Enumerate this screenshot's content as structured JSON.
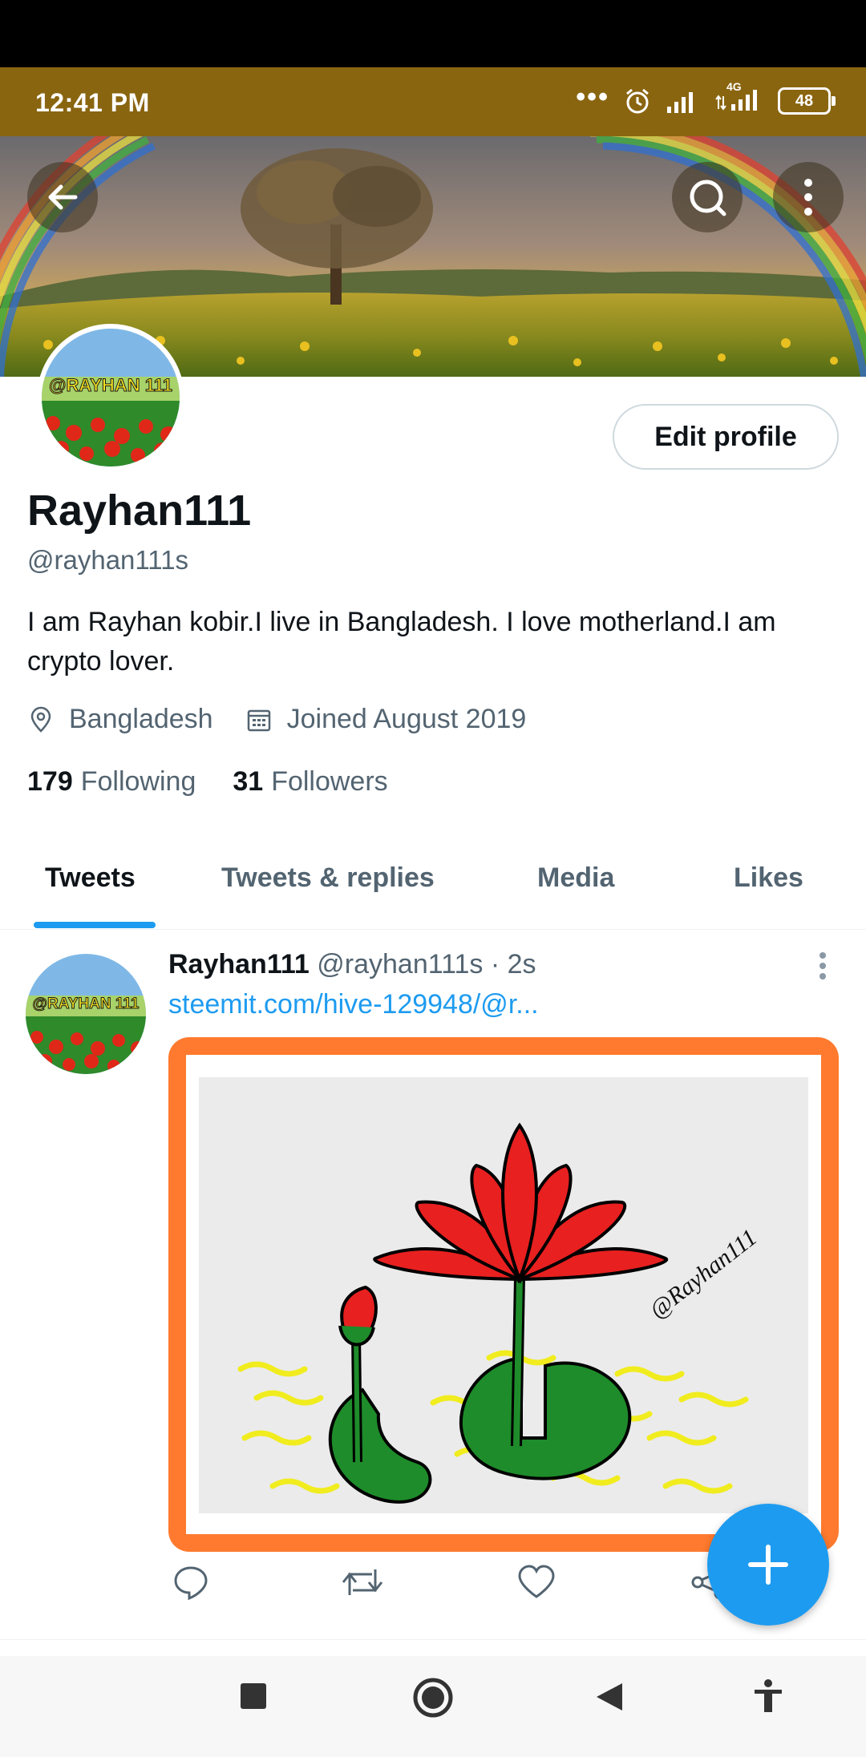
{
  "status_bar": {
    "time": "12:41 PM",
    "battery": "48",
    "network": "4G"
  },
  "header": {
    "back_icon": "arrow-left-icon",
    "search_icon": "search-icon",
    "more_icon": "more-vertical-icon"
  },
  "profile": {
    "avatar_text": "@RAYHAN 111",
    "edit_button": "Edit profile",
    "name": "Rayhan111",
    "handle": "@rayhan111s",
    "bio": "I am Rayhan kobir.I live in Bangladesh. I love motherland.I am crypto lover.",
    "location": "Bangladesh",
    "joined": "Joined August 2019",
    "following_count": "179",
    "following_label": "Following",
    "followers_count": "31",
    "followers_label": "Followers"
  },
  "tabs": [
    {
      "label": "Tweets",
      "active": true
    },
    {
      "label": "Tweets & replies",
      "active": false
    },
    {
      "label": "Media",
      "active": false
    },
    {
      "label": "Likes",
      "active": false
    }
  ],
  "tweet": {
    "author": "Rayhan111",
    "handle": "@rayhan111s",
    "time": "· 2s",
    "link": "steemit.com/hive-129948/@r...",
    "media_signature": "@Rayhan111",
    "media_frame_color": "#ff7a2e",
    "actions": [
      "reply-icon",
      "retweet-icon",
      "like-icon",
      "share-icon"
    ]
  },
  "fab": {
    "icon": "plus-icon"
  },
  "nav": {
    "items": [
      "recents-icon",
      "home-icon",
      "back-icon",
      "accessibility-icon"
    ]
  },
  "colors": {
    "accent": "#1d9bf0",
    "status_bar": "#8a6510",
    "text": "#0f1419",
    "muted": "#536471"
  }
}
